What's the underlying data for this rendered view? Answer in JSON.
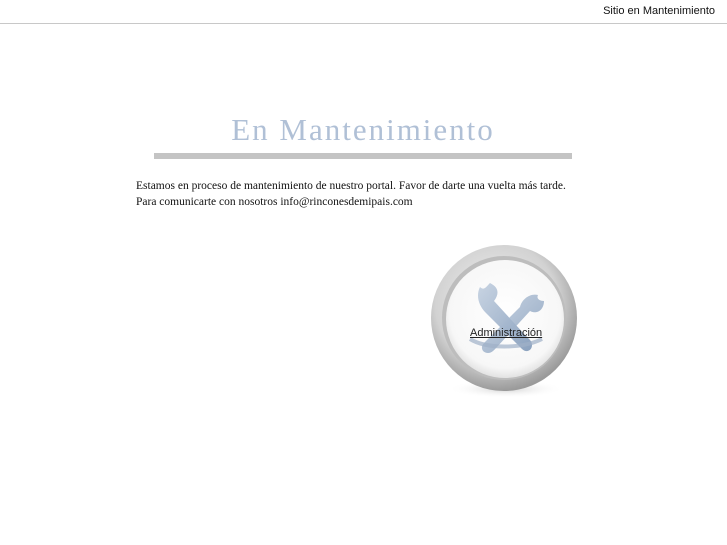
{
  "header": {
    "site_status": "Sitio en Mantenimiento"
  },
  "main": {
    "title": "En Mantenimiento",
    "message": "Estamos en proceso de mantenimiento de nuestro portal. Favor de darte una vuelta más tarde. Para comunicarte con nosotros info@rinconesdemipais.com"
  },
  "admin": {
    "link_label": "Administración",
    "icon": "tools-icon"
  },
  "colors": {
    "title": "#b0c0d6",
    "rule": "#c4c4c4",
    "ring": "#c9c9c9"
  }
}
